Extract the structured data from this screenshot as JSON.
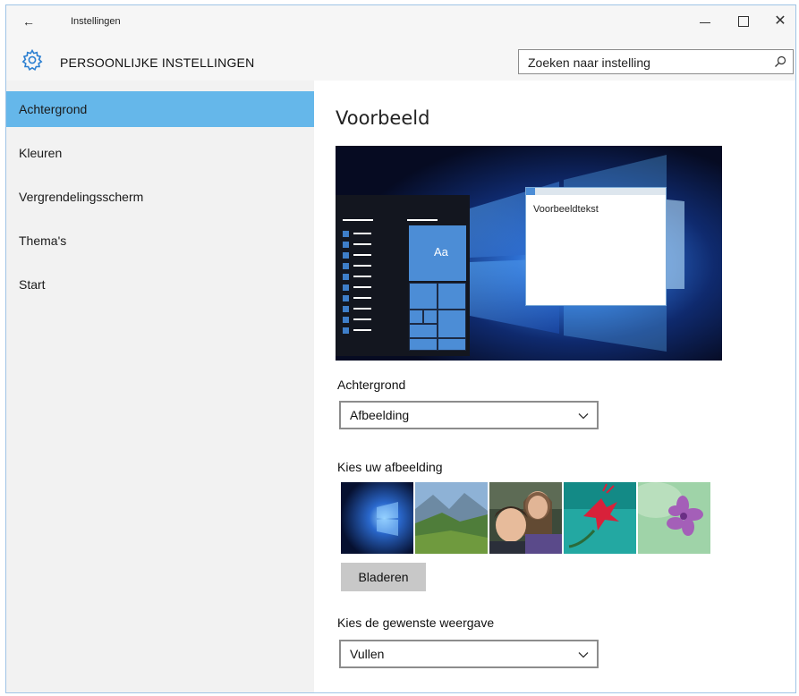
{
  "window": {
    "title": "Instellingen",
    "back_glyph": "←",
    "close_glyph": "✕",
    "accent_color": "#65b7ea"
  },
  "header": {
    "title": "PERSOONLIJKE INSTELLINGEN",
    "icon": "gear-icon",
    "search": {
      "value": "Zoeken naar instelling",
      "icon": "search-icon"
    }
  },
  "sidebar": {
    "items": [
      {
        "label": "Achtergrond",
        "active": true
      },
      {
        "label": "Kleuren",
        "active": false
      },
      {
        "label": "Vergrendelingsscherm",
        "active": false
      },
      {
        "label": "Thema's",
        "active": false
      },
      {
        "label": "Start",
        "active": false
      }
    ]
  },
  "main": {
    "preview_title": "Voorbeeld",
    "preview": {
      "tile_label": "Aa",
      "sample_text": "Voorbeeldtekst"
    },
    "background_label": "Achtergrond",
    "background_value": "Afbeelding",
    "choose_image_label": "Kies uw afbeelding",
    "thumbnails": [
      "windows-hero",
      "mountain-valley",
      "two-children",
      "red-flower",
      "purple-flower"
    ],
    "browse_label": "Bladeren",
    "fit_label": "Kies de gewenste weergave",
    "fit_value": "Vullen"
  }
}
